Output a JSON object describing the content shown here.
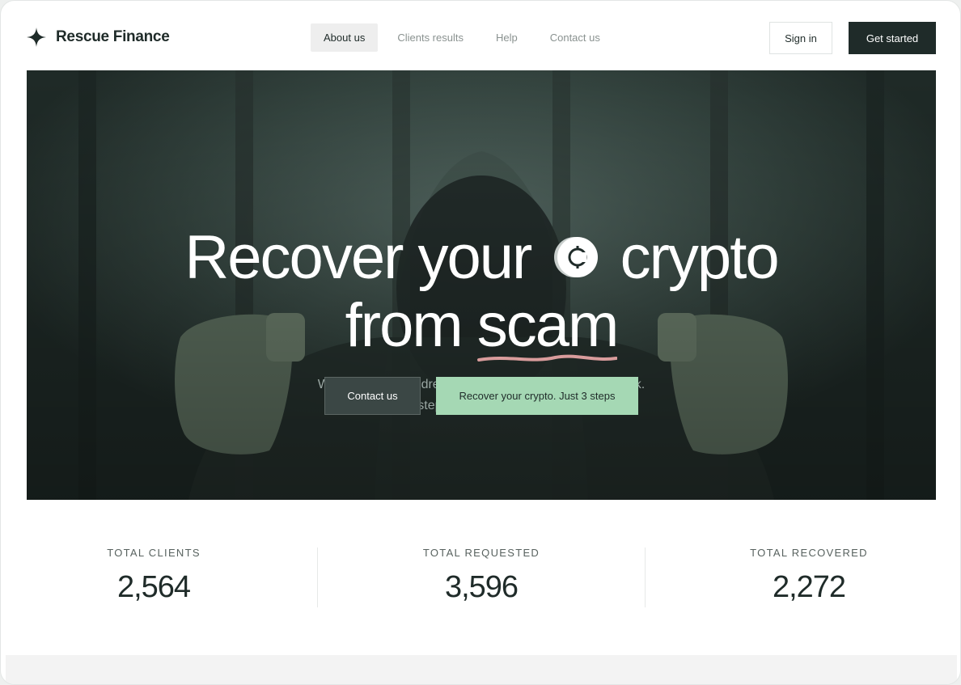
{
  "brand": {
    "name": "Rescue Finance",
    "logo_icon": "four-point-star-icon"
  },
  "nav": {
    "items": [
      {
        "label": "About us",
        "active": true
      },
      {
        "label": "Clients results",
        "active": false
      },
      {
        "label": "Help",
        "active": false
      },
      {
        "label": "Contact us",
        "active": false
      }
    ]
  },
  "header_actions": {
    "sign_in": "Sign in",
    "get_started": "Get started"
  },
  "hero": {
    "title_part1": "Recover your",
    "title_part2": "crypto",
    "title_part3": "from",
    "title_part4": "scam",
    "coin_icon": "crypto-coin-icon",
    "subtitle_line1": "We’ve helped hundreds of people to get their funds back.",
    "subtitle_line2": "Just 3 steps to get your funds back.",
    "contact_button": "Contact us",
    "recover_button": "Recover your crypto. Just 3 steps"
  },
  "stats": [
    {
      "label": "TOTAL CLIENTS",
      "value": "2,564"
    },
    {
      "label": "TOTAL REQUESTED",
      "value": "3,596"
    },
    {
      "label": "TOTAL RECOVERED",
      "value": "2,272"
    }
  ],
  "colors": {
    "primary_dark": "#1f2b29",
    "accent_green": "#a5d8b4",
    "scam_underline": "#d99c9c",
    "hero_bg": "#2c3a36"
  }
}
